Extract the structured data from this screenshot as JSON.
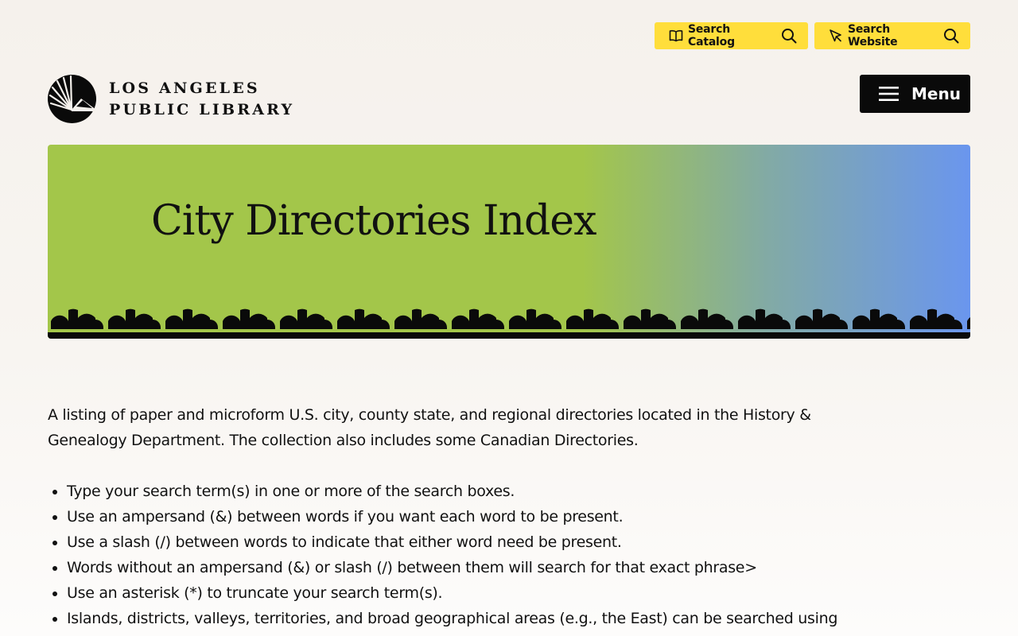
{
  "header": {
    "search_catalog": "Search Catalog",
    "search_website": "Search Website",
    "logo_line1": "LOS ANGELES",
    "logo_line2": "PUBLIC LIBRARY",
    "menu_label": "Menu"
  },
  "hero": {
    "title": "City Directories Index"
  },
  "main": {
    "intro": "A listing of paper and microform U.S. city, county state, and regional directories located in the History & Genealogy Department. The collection also includes some Canadian Directories.",
    "tips": [
      "Type your search term(s) in one or more of the search boxes.",
      "Use an ampersand (&) between words if you want each word to be present.",
      "Use a slash (/) between words to indicate that either word need be present.",
      "Words without an ampersand (&) or slash (/) between them will search for that exact phrase>",
      "Use an asterisk (*) to truncate your search term(s).",
      "Islands, districts, valleys, territories, and broad geographical areas (e.g., the East) can be searched using"
    ]
  },
  "colors": {
    "accent_yellow": "#ffde3b",
    "hero_green": "#a3c64a",
    "hero_blue": "#6a96ee",
    "ink": "#111111"
  },
  "icons": [
    "book-icon",
    "search-icon",
    "cursor-icon",
    "hamburger-icon",
    "library-logo-icon"
  ]
}
